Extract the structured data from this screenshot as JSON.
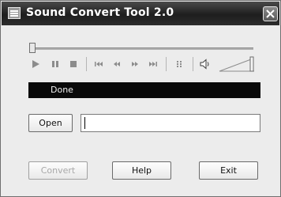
{
  "window": {
    "title": "Sound Convert Tool 2.0",
    "icons": {
      "app": "app-icon",
      "close": "close-icon"
    }
  },
  "player": {
    "seek_progress": 0,
    "controls": [
      "play-icon",
      "pause-icon",
      "stop-icon",
      "skip-start-icon",
      "rewind-icon",
      "fast-forward-icon",
      "skip-end-icon",
      "playlist-icon",
      "speaker-icon"
    ],
    "status": "Done"
  },
  "file": {
    "open_label": "Open",
    "path_value": ""
  },
  "actions": {
    "convert_label": "Convert",
    "help_label": "Help",
    "exit_label": "Exit"
  },
  "colors": {
    "titlebar": "#2a2a2a",
    "status_background": "#0a0a0a",
    "window_background": "#ececec"
  }
}
